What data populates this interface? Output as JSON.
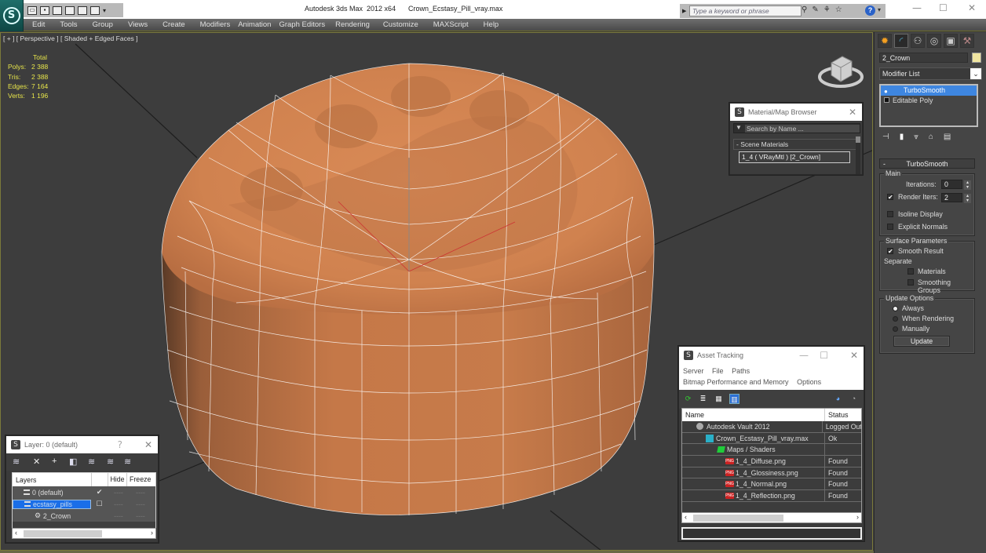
{
  "window": {
    "app_title": "Autodesk 3ds Max  2012 x64",
    "file_name": "Crown_Ecstasy_Pill_vray.max",
    "minimize": "—",
    "maximize": "☐",
    "close": "✕"
  },
  "quick_access": {
    "icons": [
      "open-icon",
      "save-icon",
      "new-icon",
      "hold-icon",
      "undo-icon",
      "redo-icon"
    ],
    "dropdown": "▾"
  },
  "infocenter": {
    "search_placeholder": "Type a keyword or phrase",
    "icons": [
      "binoculars-icon",
      "wrench-icon",
      "satellite-icon",
      "star-icon"
    ],
    "help_label": "?"
  },
  "menu": [
    "Edit",
    "Tools",
    "Group",
    "Views",
    "Create",
    "Modifiers",
    "Animation",
    "Graph Editors",
    "Rendering",
    "Customize",
    "MAXScript",
    "Help"
  ],
  "viewport": {
    "label": "[ + ] [ Perspective ] [ Shaded + Edged Faces ]",
    "stats": {
      "header": "Total",
      "rows": [
        {
          "k": "Polys:",
          "v": "2 388"
        },
        {
          "k": "Tris:",
          "v": "2 388"
        },
        {
          "k": "Edges:",
          "v": "7 164"
        },
        {
          "k": "Verts:",
          "v": "1 196"
        }
      ]
    }
  },
  "material_browser": {
    "title": "Material/Map Browser",
    "search_placeholder": "Search by Name ...",
    "section": "- Scene Materials",
    "entry": "1_4  ( VRayMtl )  [2_Crown]"
  },
  "asset_tracking": {
    "title": "Asset Tracking",
    "menu_row1": [
      "Server",
      "File",
      "Paths"
    ],
    "menu_row2": [
      "Bitmap Performance and Memory",
      "Options"
    ],
    "columns": [
      "Name",
      "Status"
    ],
    "rows": [
      {
        "name": "Autodesk Vault 2012",
        "status": "Logged Out",
        "icon": "vault-icon",
        "indent": 1
      },
      {
        "name": "Crown_Ecstasy_Pill_vray.max",
        "status": "Ok",
        "icon": "max-file-icon",
        "indent": 2
      },
      {
        "name": "Maps / Shaders",
        "status": "",
        "icon": "maps-icon",
        "indent": 3
      },
      {
        "name": "1_4_Diffuse.png",
        "status": "Found",
        "icon": "png-icon",
        "indent": 4
      },
      {
        "name": "1_4_Glossiness.png",
        "status": "Found",
        "icon": "png-icon",
        "indent": 4
      },
      {
        "name": "1_4_Normal.png",
        "status": "Found",
        "icon": "png-icon",
        "indent": 4
      },
      {
        "name": "1_4_Reflection.png",
        "status": "Found",
        "icon": "png-icon",
        "indent": 4
      }
    ]
  },
  "layer_window": {
    "title": "Layer: 0 (default)",
    "help": "?",
    "columns": [
      "Layers",
      "",
      "Hide",
      "Freeze"
    ],
    "rows": [
      {
        "name": "0 (default)",
        "current": "✔",
        "hide": "----",
        "freeze": "----",
        "selected": false
      },
      {
        "name": "ecstasy_pills",
        "current": "☐",
        "hide": "----",
        "freeze": "----",
        "selected": true
      },
      {
        "name": "2_Crown",
        "current": "",
        "hide": "----",
        "freeze": "----",
        "selected": false
      }
    ]
  },
  "command_panel": {
    "object_name": "2_Crown",
    "object_color": "#f1e6a1",
    "modifier_list_label": "Modifier List",
    "stack": [
      {
        "label": "TurboSmooth",
        "selected": true
      },
      {
        "label": "Editable Poly",
        "selected": false
      }
    ],
    "turbosmooth": {
      "title": "TurboSmooth",
      "main_group": "Main",
      "iterations_label": "Iterations:",
      "iterations": "0",
      "render_iters_label": "Render Iters:",
      "render_iters": "2",
      "render_iters_checked": true,
      "isoline_label": "Isoline Display",
      "isoline_checked": false,
      "explicit_label": "Explicit Normals",
      "explicit_checked": false,
      "surface_group": "Surface Parameters",
      "smooth_result_label": "Smooth Result",
      "smooth_result_checked": true,
      "separate_label": "Separate",
      "materials_label": "Materials",
      "smoothing_groups_label": "Smoothing Groups",
      "update_group": "Update Options",
      "update_options": [
        "Always",
        "When Rendering",
        "Manually"
      ],
      "update_selected": "Always",
      "update_button": "Update"
    }
  }
}
